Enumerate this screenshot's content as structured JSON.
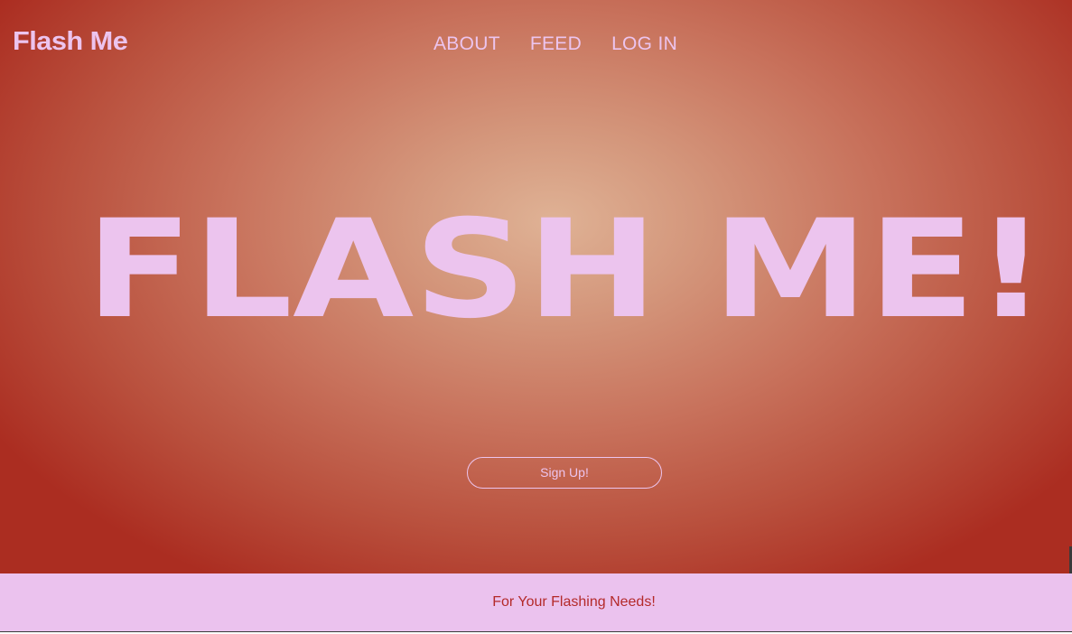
{
  "brand": {
    "name": "Flash Me"
  },
  "nav": {
    "items": [
      {
        "label": "ABOUT"
      },
      {
        "label": "FEED"
      },
      {
        "label": "LOG IN"
      }
    ]
  },
  "hero": {
    "headline": "FLASH ME!",
    "cta_label": "Sign Up!"
  },
  "footer": {
    "tagline": "For Your Flashing Needs!"
  },
  "colors": {
    "accent_pink": "#ecc4ee",
    "hero_center": "#dfb295",
    "hero_edge": "#ab2d21",
    "footer_bg": "#ebc2ee",
    "footer_text": "#b42a2a"
  }
}
